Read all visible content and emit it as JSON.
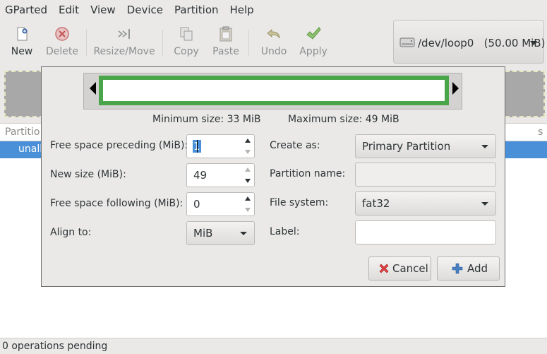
{
  "menubar": [
    "GParted",
    "Edit",
    "View",
    "Device",
    "Partition",
    "Help"
  ],
  "toolbar": {
    "new": "New",
    "delete": "Delete",
    "resize_move": "Resize/Move",
    "copy": "Copy",
    "paste": "Paste",
    "undo": "Undo",
    "apply": "Apply"
  },
  "device": {
    "label": "/dev/loop0   (50.00 MiB)"
  },
  "partition_list": {
    "header_left": "Partitio",
    "header_right": "s",
    "row_label": "unall"
  },
  "status": "0 operations pending",
  "dialog": {
    "min_size": "Minimum size: 33 MiB",
    "max_size": "Maximum size: 49 MiB",
    "free_preceding_label": "Free space preceding (MiB):",
    "free_preceding_value": "1",
    "new_size_label": "New size (MiB):",
    "new_size_value": "49",
    "free_following_label": "Free space following (MiB):",
    "free_following_value": "0",
    "align_label": "Align to:",
    "align_value": "MiB",
    "create_as_label": "Create as:",
    "create_as_value": "Primary Partition",
    "partition_name_label": "Partition name:",
    "file_system_label": "File system:",
    "file_system_value": "fat32",
    "label_label": "Label:",
    "cancel": "Cancel",
    "add": "Add",
    "colors": {
      "partition_border": "#4aa54a",
      "selection": "#4a90d9"
    }
  }
}
